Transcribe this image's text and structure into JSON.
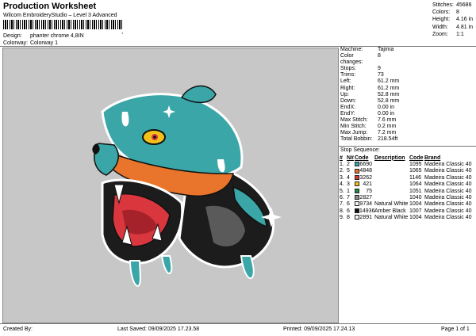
{
  "header": {
    "title": "Production Worksheet",
    "subtitle": "Wilcom EmbroideryStudio – Level 3 Advanced",
    "barcode_mark": ",",
    "design_label": "Design:",
    "design_value": "phanter chrome 4,8IN",
    "colorway_label": "Colorway:",
    "colorway_value": "Colorway 1"
  },
  "stats": [
    {
      "label": "Stitches:",
      "value": "45686"
    },
    {
      "label": "Colors:",
      "value": "8"
    },
    {
      "label": "Height:",
      "value": "4.16 in"
    },
    {
      "label": "Width:",
      "value": "4.81 in"
    },
    {
      "label": "Zoom:",
      "value": "1:1"
    }
  ],
  "info": [
    {
      "label": "Machine:",
      "value": "Tajima"
    },
    {
      "label": "Color changes:",
      "value": "8"
    },
    {
      "label": "Stops:",
      "value": "9"
    },
    {
      "label": "Trims:",
      "value": "73"
    },
    {
      "label": "Left:",
      "value": "61.2 mm"
    },
    {
      "label": "Right:",
      "value": "61.2 mm"
    },
    {
      "label": "Up:",
      "value": "52.8 mm"
    },
    {
      "label": "Down:",
      "value": "52.8 mm"
    },
    {
      "label": "EndX:",
      "value": "0.00 in"
    },
    {
      "label": "EndY:",
      "value": "0.00 in"
    },
    {
      "label": "Max Stitch:",
      "value": "7.6 mm"
    },
    {
      "label": "Min Stitch:",
      "value": "0.2 mm"
    },
    {
      "label": "Max Jump:",
      "value": "7.2 mm"
    },
    {
      "label": "Total Bobbin:",
      "value": "218.54ft"
    }
  ],
  "stop_sequence": {
    "title": "Stop Sequence:",
    "headers": [
      "#",
      "N#",
      "Code",
      "Description",
      "Code",
      "Brand"
    ],
    "rows": [
      {
        "num": "1.",
        "n": "2",
        "color": "#3aa6a8",
        "code": "6690",
        "desc": "",
        "code2": "1095",
        "brand": "Madeira Classic 40"
      },
      {
        "num": "2.",
        "n": "5",
        "color": "#e8752b",
        "code": "4848",
        "desc": "",
        "code2": "1065",
        "brand": "Madeira Classic 40"
      },
      {
        "num": "3.",
        "n": "4",
        "color": "#d9363e",
        "code": "3262",
        "desc": "",
        "code2": "1146",
        "brand": "Madeira Classic 40"
      },
      {
        "num": "4.",
        "n": "3",
        "color": "#f2c21b",
        "code": "421",
        "desc": "",
        "code2": "1064",
        "brand": "Madeira Classic 40"
      },
      {
        "num": "5.",
        "n": "1",
        "color": "#1f8a4c",
        "code": "75",
        "desc": "",
        "code2": "1051",
        "brand": "Madeira Classic 40"
      },
      {
        "num": "6.",
        "n": "7",
        "color": "#8c8c8c",
        "code": "2827",
        "desc": "",
        "code2": "1040",
        "brand": "Madeira Classic 40"
      },
      {
        "num": "7.",
        "n": "6",
        "color": "#f4f4f4",
        "code": "9734",
        "desc": "Natural White",
        "code2": "1004",
        "brand": "Madeira Classic 40"
      },
      {
        "num": "8.",
        "n": "6",
        "color": "#111111",
        "code": "14936",
        "desc": "Amber Black",
        "code2": "1007",
        "brand": "Madeira Classic 40"
      },
      {
        "num": "9.",
        "n": "8",
        "color": "#f4f4f4",
        "code": "2891",
        "desc": "Natural White",
        "code2": "1004",
        "brand": "Madeira Classic 40"
      }
    ]
  },
  "footer": {
    "created_by": "Created By:",
    "last_saved": "Last Saved: 09/09/2025 17.23.58",
    "printed": "Printed: 09/09/2025 17.24.13",
    "page": "Page 1 of 1"
  },
  "design_image": "embroidered-panther-head",
  "colors": {
    "canvas": "#c7c7c7",
    "teal": "#3aa6a8",
    "orange": "#e8752b",
    "red": "#d9363e",
    "black": "#111111"
  }
}
